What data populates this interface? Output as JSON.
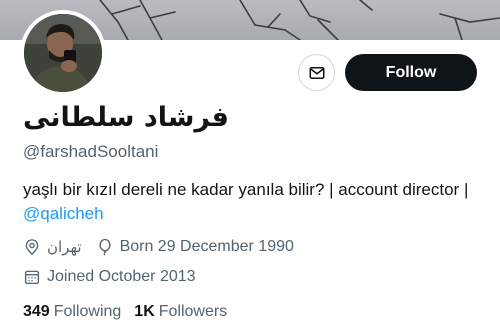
{
  "profile": {
    "display_name": "فرشاد سلطانی",
    "handle": "@farshadSooltani",
    "bio_text": "yaşlı bir kızıl dereli ne kadar yanıla bilir? | account director | ",
    "bio_mention": "@qalicheh",
    "location": "تهران",
    "birthday": "Born 29 December 1990",
    "joined": "Joined October 2013"
  },
  "actions": {
    "follow_label": "Follow"
  },
  "stats": {
    "following_count": "349",
    "following_label": "Following",
    "followers_count": "1K",
    "followers_label": "Followers"
  },
  "icons": {
    "message": "mail-icon",
    "location": "location-pin-icon",
    "birthday": "balloon-icon",
    "joined": "calendar-icon"
  },
  "colors": {
    "text_primary": "#0f1419",
    "text_secondary": "#536471",
    "link": "#1d9bf0",
    "button_dark": "#0f1419",
    "border": "#cfd9de"
  }
}
